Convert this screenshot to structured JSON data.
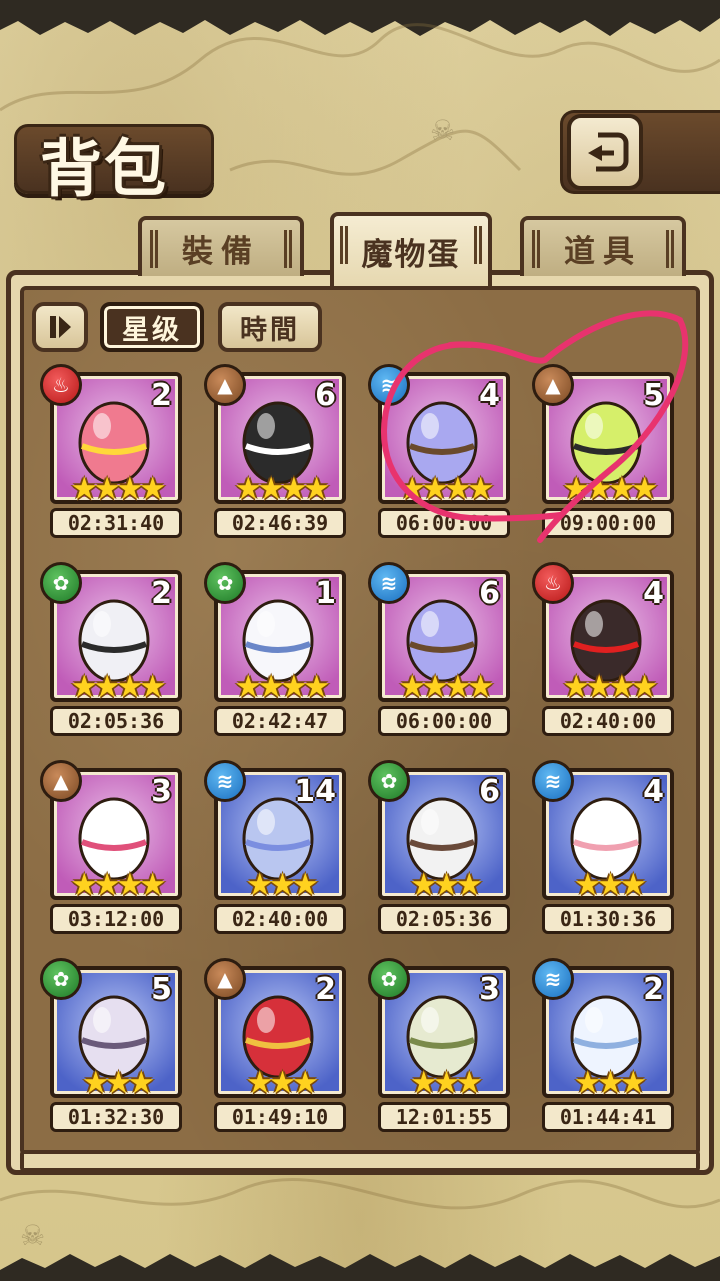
{
  "header": {
    "title": "背包"
  },
  "tabs": [
    {
      "label": "裝備",
      "active": false
    },
    {
      "label": "魔物蛋",
      "active": true
    },
    {
      "label": "道具",
      "active": false
    }
  ],
  "sort": {
    "options": [
      "星级",
      "時間"
    ],
    "active": "星级"
  },
  "eggs": [
    {
      "element": "fire",
      "count": "2",
      "stars": "★★★★",
      "timer": "02:31:40",
      "frame": "pink",
      "color": "#f07a8f",
      "accent": "#ffd83a"
    },
    {
      "element": "earth",
      "count": "6",
      "stars": "★★★★",
      "timer": "02:46:39",
      "frame": "pink",
      "color": "#2b2b2b",
      "accent": "#ffffff"
    },
    {
      "element": "water",
      "count": "4",
      "stars": "★★★★",
      "timer": "06:00:00",
      "frame": "pink",
      "color": "#a9a8f0",
      "accent": "#6a4a2c"
    },
    {
      "element": "earth",
      "count": "5",
      "stars": "★★★★",
      "timer": "09:00:00",
      "frame": "pink",
      "color": "#d6ef6a",
      "accent": "#2b2b2b"
    },
    {
      "element": "wood",
      "count": "2",
      "stars": "★★★★",
      "timer": "02:05:36",
      "frame": "pink",
      "color": "#f0f0f5",
      "accent": "#2b2b2b"
    },
    {
      "element": "wood",
      "count": "1",
      "stars": "★★★★",
      "timer": "02:42:47",
      "frame": "pink",
      "color": "#f7f7fb",
      "accent": "#6a86c8"
    },
    {
      "element": "water",
      "count": "6",
      "stars": "★★★★",
      "timer": "06:00:00",
      "frame": "pink",
      "color": "#a9a8f0",
      "accent": "#6a4a2c"
    },
    {
      "element": "fire",
      "count": "4",
      "stars": "★★★★",
      "timer": "02:40:00",
      "frame": "pink",
      "color": "#3a2a2a",
      "accent": "#e02020"
    },
    {
      "element": "earth",
      "count": "3",
      "stars": "★★★★",
      "timer": "03:12:00",
      "frame": "pink",
      "color": "#ffffff",
      "accent": "#e0507a"
    },
    {
      "element": "water",
      "count": "14",
      "stars": "★★★",
      "timer": "02:40:00",
      "frame": "blue",
      "color": "#b9c6f0",
      "accent": "#7b8ee0"
    },
    {
      "element": "wood",
      "count": "6",
      "stars": "★★★",
      "timer": "02:05:36",
      "frame": "blue",
      "color": "#f2f2f2",
      "accent": "#6a4a3a"
    },
    {
      "element": "water",
      "count": "4",
      "stars": "★★★",
      "timer": "01:30:36",
      "frame": "blue",
      "color": "#ffffff",
      "accent": "#f0a0b0"
    },
    {
      "element": "wood",
      "count": "5",
      "stars": "★★★",
      "timer": "01:32:30",
      "frame": "blue",
      "color": "#e6dff0",
      "accent": "#6a5a7a"
    },
    {
      "element": "earth",
      "count": "2",
      "stars": "★★★",
      "timer": "01:49:10",
      "frame": "blue",
      "color": "#d6303a",
      "accent": "#f0c040"
    },
    {
      "element": "wood",
      "count": "3",
      "stars": "★★★",
      "timer": "12:01:55",
      "frame": "blue",
      "color": "#e6ead0",
      "accent": "#7a8a4a"
    },
    {
      "element": "water",
      "count": "2",
      "stars": "★★★",
      "timer": "01:44:41",
      "frame": "blue",
      "color": "#eef4ff",
      "accent": "#8fb0e0"
    }
  ],
  "annotation_color": "#e8336e"
}
